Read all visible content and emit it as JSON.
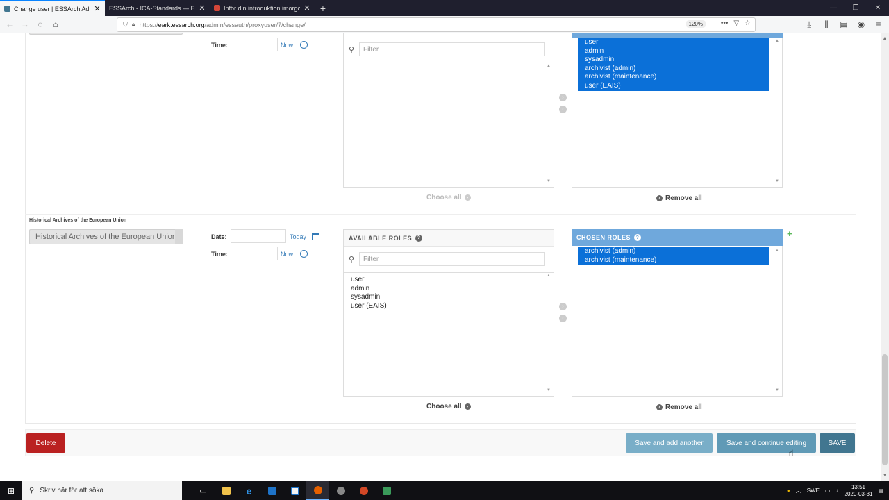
{
  "browser": {
    "tabs": [
      {
        "label": "Change user | ESSArch Admini",
        "active": true,
        "color": "#417690"
      },
      {
        "label": "ESSArch - ICA-Standards — ESSArc",
        "active": false,
        "color": "#ffffff"
      },
      {
        "label": "Inför din introduktion imorgon",
        "active": false,
        "color": "#d44638"
      }
    ],
    "new_tab": "+",
    "url_host": "eark.essarch.org",
    "url_prefix": "https://",
    "url_path": "/admin/essauth/proxyuser/7/change/",
    "zoom": "120%"
  },
  "block1": {
    "time_label": "Time:",
    "now_label": "Now",
    "filter_placeholder": "Filter",
    "available_options": [],
    "chosen_options": [
      "user",
      "admin",
      "sysadmin",
      "archivist (admin)",
      "archivist (maintenance)",
      "user (EAIS)"
    ],
    "choose_all": "Choose all",
    "remove_all": "Remove all"
  },
  "block2": {
    "archive_label": "Historical Archives of the European Union",
    "archive_button": "Historical Archives of the European Union",
    "date_label": "Date:",
    "today_label": "Today",
    "time_label": "Time:",
    "now_label": "Now",
    "available_header": "AVAILABLE ROLES",
    "chosen_header": "CHOSEN ROLES",
    "filter_placeholder": "Filter",
    "available_options": [
      "user",
      "admin",
      "sysadmin",
      "user (EAIS)"
    ],
    "chosen_options": [
      "archivist (admin)",
      "archivist (maintenance)"
    ],
    "choose_all": "Choose all",
    "remove_all": "Remove all",
    "add_symbol": "+"
  },
  "submit": {
    "delete": "Delete",
    "save_add_another": "Save and add another",
    "save_continue": "Save and continue editing",
    "save": "SAVE"
  },
  "taskbar": {
    "search_placeholder": "Skriv här för att söka",
    "language": "SWE",
    "time": "13:51",
    "date": "2020-03-31"
  },
  "colors": {
    "chosen_header": "#6fa8dc",
    "selected_option": "#0b70d8",
    "delete": "#ba2121",
    "save": "#417690"
  }
}
